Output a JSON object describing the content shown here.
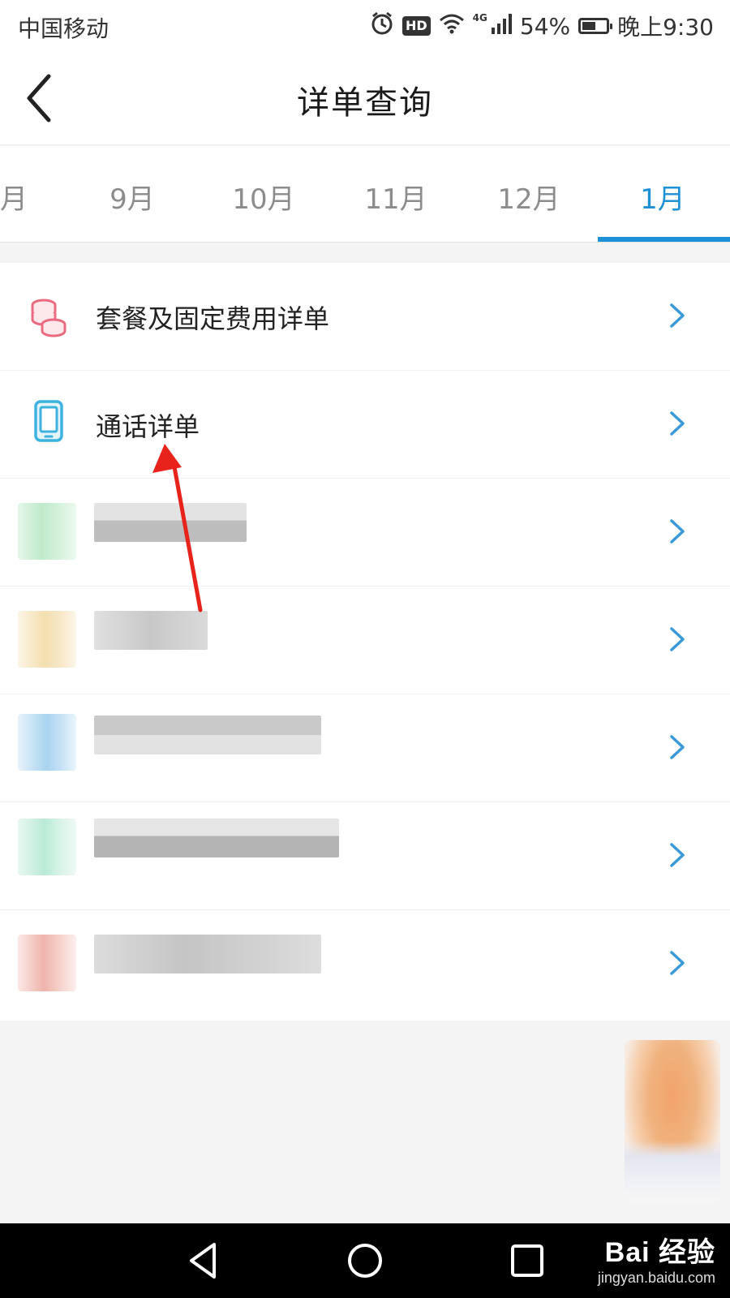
{
  "status_bar": {
    "carrier": "中国移动",
    "network": "4G",
    "battery_level": "54%",
    "time": "晚上9:30"
  },
  "header": {
    "title": "详单查询"
  },
  "month_tabs": {
    "items": [
      {
        "label": "月"
      },
      {
        "label": "9月"
      },
      {
        "label": "10月"
      },
      {
        "label": "11月"
      },
      {
        "label": "12月"
      },
      {
        "label": "1月"
      }
    ],
    "active_index": 5,
    "accent_color": "#1e90d6"
  },
  "menu": {
    "items": [
      {
        "label": "套餐及固定费用详单",
        "icon": "coins-icon"
      },
      {
        "label": "通话详单",
        "icon": "phone-device-icon"
      }
    ]
  },
  "watermark": {
    "logo": "Bai 经验",
    "url": "jingyan.baidu.com"
  }
}
